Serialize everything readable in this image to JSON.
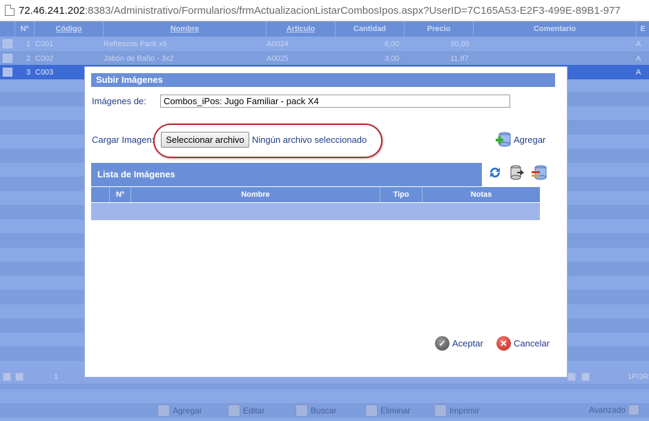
{
  "browser": {
    "url_host": "72.46.241.202",
    "url_rest": ":8383/Administrativo/Formularios/frmActualizacionListarCombosIpos.aspx?UserID=7C165A53-E2F3-499E-89B1-977"
  },
  "grid": {
    "headers": {
      "no": "Nº",
      "codigo": "Código",
      "nombre": "Nombre",
      "articulo": "Artículo",
      "cantidad": "Cantidad",
      "precio": "Precio",
      "comentario": "Comentario",
      "e": "E"
    },
    "rows": [
      {
        "no": "1",
        "codigo": "C001",
        "nombre": "Refrescos Pack x6",
        "articulo": "A0024",
        "cantidad": "6,00",
        "precio": "30,00",
        "e": "A"
      },
      {
        "no": "2",
        "codigo": "C002",
        "nombre": "Jabón de Baño - 3x2",
        "articulo": "A0025",
        "cantidad": "3,00",
        "precio": "11,87",
        "e": "A"
      },
      {
        "no": "3",
        "codigo": "C003",
        "nombre": "",
        "articulo": "",
        "cantidad": "",
        "precio": "",
        "e": "A"
      }
    ],
    "pager": {
      "page": "1",
      "summary": "1P/3R"
    }
  },
  "toolbar": {
    "agregar": "Agregar",
    "editar": "Editar",
    "buscar": "Buscar",
    "eliminar": "Eliminar",
    "imprimir": "Imprimir",
    "avanzado": "Avanzado"
  },
  "modal": {
    "title": "Subir Imágenes",
    "imagenes_de_label": "Imágenes de:",
    "imagenes_de_value": "Combos_iPos: Jugo Familiar - pack X4",
    "cargar_label": "Cargar Imagen:",
    "file_button": "Seleccionar archivo",
    "no_file": "Ningún archivo seleccionado",
    "agregar": "Agregar",
    "lista_title": "Lista de Imágenes",
    "columns": {
      "no": "Nº",
      "nombre": "Nombre",
      "tipo": "Tipo",
      "notas": "Notas"
    },
    "aceptar": "Aceptar",
    "cancelar": "Cancelar"
  },
  "colors": {
    "accent": "#6a8fd8",
    "selected_row": "#3d6bd6",
    "highlight_oval": "#b4262a"
  }
}
